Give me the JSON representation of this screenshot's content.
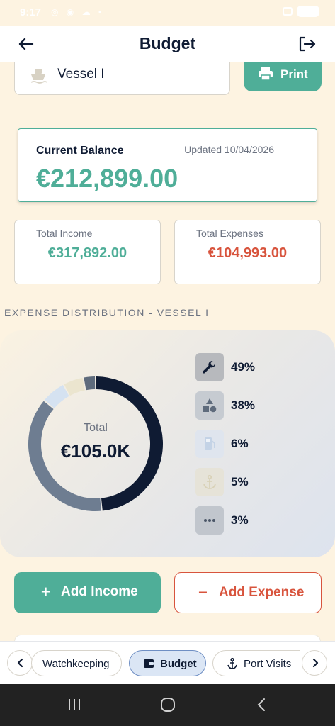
{
  "status_bar": {
    "time": "9:17"
  },
  "header": {
    "title": "Budget",
    "back_icon": "arrow-left-icon",
    "logout_icon": "logout-icon"
  },
  "vessel_selector": {
    "value": "Vessel I",
    "icon": "ship-icon"
  },
  "print_button": {
    "label": "Print",
    "icon": "printer-icon"
  },
  "balance": {
    "title": "Current Balance",
    "updated": "Updated 10/04/2026",
    "amount": "€212,899.00"
  },
  "stats": {
    "income_label": "Total Income",
    "income_value": "€317,892.00",
    "expenses_label": "Total Expenses",
    "expenses_value": "€104,993.00"
  },
  "expense_section": {
    "title": "EXPENSE DISTRIBUTION - VESSEL I"
  },
  "donut": {
    "total_label": "Total",
    "total_value": "€105.0K"
  },
  "chart_data": {
    "type": "pie",
    "center_label": "Total",
    "center_value": "€105.0K",
    "values": [
      49,
      38,
      6,
      5,
      3
    ],
    "slice_colors": [
      "#0f1b33",
      "#6e7d91",
      "#d5e2f1",
      "#ebe5cf",
      "#5e6b7c"
    ],
    "legend": [
      {
        "icon": "wrench-icon",
        "percent": "49%"
      },
      {
        "icon": "shapes-icon",
        "percent": "38%"
      },
      {
        "icon": "fuel-icon",
        "percent": "6%"
      },
      {
        "icon": "anchor-icon",
        "percent": "5%"
      },
      {
        "icon": "more-icon",
        "percent": "3%"
      }
    ]
  },
  "actions": {
    "add_income_sign": "+",
    "add_income": "Add Income",
    "add_expense_sign": "−",
    "add_expense": "Add Expense"
  },
  "bottom_nav": {
    "tabs": [
      {
        "label": "Watchkeeping"
      },
      {
        "label": "Budget",
        "icon": "wallet-icon",
        "active": true
      },
      {
        "label": "Port Visits",
        "icon": "anchor-icon"
      }
    ]
  },
  "colors": {
    "accent": "#4fae98",
    "expense": "#d8543d",
    "navy": "#0f1b33",
    "background": "#fdf3e1"
  }
}
